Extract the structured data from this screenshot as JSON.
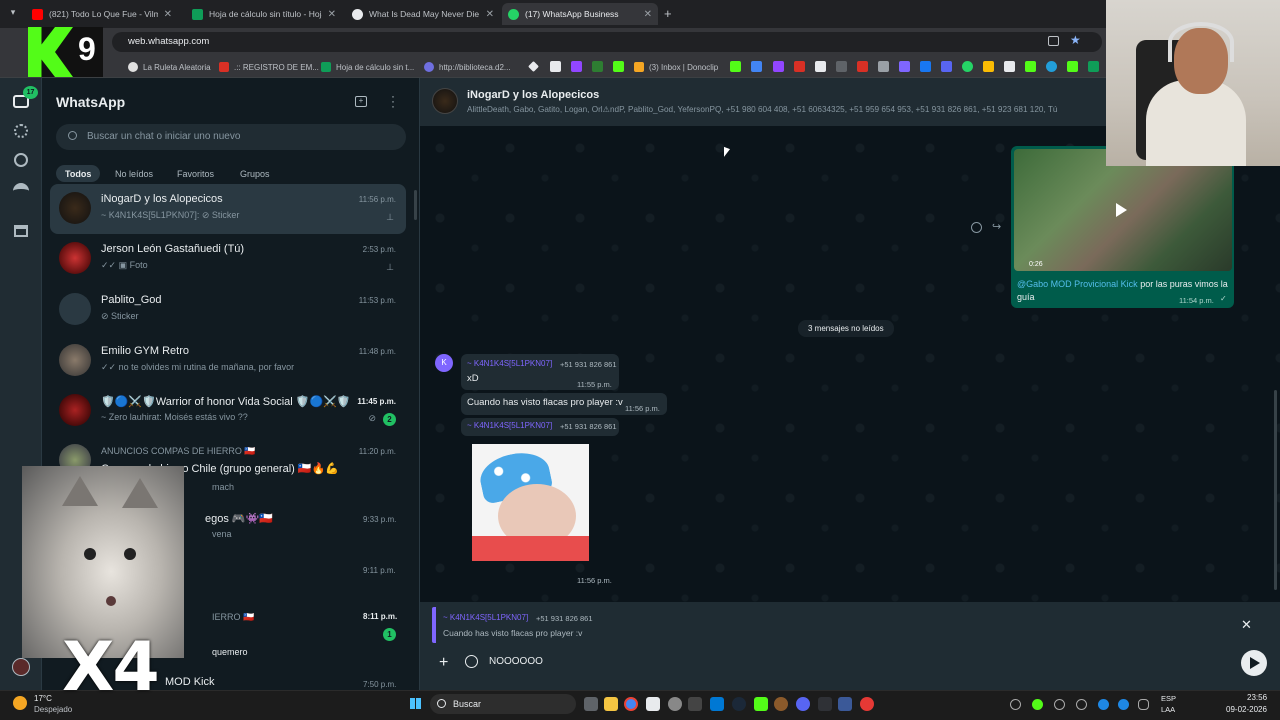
{
  "browser": {
    "tabs": [
      {
        "title": "(821) Todo Lo Que Fue - Vilma",
        "color": "#ff0000"
      },
      {
        "title": "Hoja de cálculo sin título - Hoja",
        "color": "#0f9d58"
      },
      {
        "title": "What Is Dead May Never Die -",
        "color": "#e8eaed"
      },
      {
        "title": "(17) WhatsApp Business",
        "color": "#25d366"
      }
    ],
    "url": "web.whatsapp.com",
    "bookmarks": [
      {
        "label": "La Ruleta Aleatoria",
        "color": "#e0e0e0"
      },
      {
        "label": ".:: REGISTRO DE EM...",
        "color": "#d93025"
      },
      {
        "label": "Hoja de cálculo sin t...",
        "color": "#0f9d58"
      },
      {
        "label": "http://biblioteca.d2...",
        "color": "#6f6fe0"
      },
      {
        "label": "(3) Inbox | Donoclip",
        "color": "#f5a623"
      }
    ]
  },
  "whatsapp": {
    "title": "WhatsApp",
    "unread_count": "17",
    "search_placeholder": "Buscar un chat o iniciar uno nuevo",
    "filters": [
      "Todos",
      "No leídos",
      "Favoritos",
      "Grupos"
    ],
    "chats": [
      {
        "name": "iNogarD y los Alopecicos",
        "preview": "~ K4N1K4S[5L1PKN07]: ⊘ Sticker",
        "time": "11:56 p.m.",
        "pinned": true
      },
      {
        "name": "Jerson León Gastañuedi (Tú)",
        "preview": "✓✓ ▣ Foto",
        "time": "2:53 p.m.",
        "pinned": true
      },
      {
        "name": "Pablito_God",
        "preview": "⊘ Sticker",
        "time": "11:53 p.m."
      },
      {
        "name": "Emilio GYM Retro",
        "preview": "✓✓ no te olvides mi rutina de mañana, por favor",
        "time": "11:48 p.m."
      },
      {
        "name": "🛡️🔵⚔️🛡️Warrior of honor Vida Social 🛡️🔵⚔️🛡️",
        "preview": "~ Zero lauhirat: Moisés estás vivo ??",
        "time": "11:45 p.m.",
        "badge": "2"
      },
      {
        "name": "ANUNCIOS COMPAS DE HIERRO 🇨🇱",
        "preview": "Compas de hierro Chile (grupo general) 🇨🇱🔥💪",
        "time": "11:20 p.m."
      },
      {
        "name": "",
        "preview": "mach",
        "time": ""
      },
      {
        "name": "egos 🎮👾🇨🇱",
        "preview": "vena",
        "time": "9:33 p.m."
      },
      {
        "name": "",
        "preview": "",
        "time": "9:11 p.m."
      },
      {
        "name": "IERRO 🇨🇱",
        "preview": "quemero",
        "time": "8:11 p.m.",
        "badge": "1"
      },
      {
        "name": "MOD Kick",
        "preview": "",
        "time": "7:50 p.m."
      }
    ],
    "chat": {
      "name": "iNogarD y los Alopecicos",
      "members": "AlittleDeath, Gabo, Gatito,  Logan, Orl⚠ndP, Pablito_God, YefersonPQ, +51 980 604 408, +51 60634325, +51 959 654 953, +51 931 826 861, +51 923 681 120, Tú",
      "video_msg": {
        "duration": "0:26",
        "mention": "@Gabo MOD Provicional Kick",
        "text": " por las puras vimos la guía",
        "time": "11:54 p.m."
      },
      "unread_divider": "3 mensajes no leídos",
      "messages": [
        {
          "sender": "~ K4N1K4S[5L1PKN07]",
          "phone": "+51 931 826 861",
          "text": "xD",
          "time": "11:55 p.m."
        },
        {
          "text": "Cuando has visto flacas pro player :v",
          "time": "11:56 p.m."
        },
        {
          "sender": "~ K4N1K4S[5L1PKN07]",
          "phone": "+51 931 826 861",
          "time": "11:56 p.m."
        }
      ],
      "reply": {
        "sender": "~ K4N1K4S[5L1PKN07]",
        "phone": "+51 931 826 861",
        "text": "Cuando has visto flacas pro player :v"
      },
      "input": "NOOOOOO"
    }
  },
  "overlay": {
    "logo": "9",
    "cat_text": "X4"
  },
  "taskbar": {
    "weather_temp": "17°C",
    "weather_desc": "Despejado",
    "search": "Buscar",
    "lang1": "ESP",
    "lang2": "LAA",
    "time": "23:56",
    "date": "09-02-2026"
  },
  "colors": {
    "accent": "#25d366",
    "panel": "#111b21",
    "chatbg": "#0b141a",
    "incoming": "#202c33",
    "outgoing": "#005c4b"
  },
  "icons": [
    "search-icon",
    "pin-icon",
    "mute-icon",
    "send-icon",
    "plus-icon",
    "sticker-icon",
    "close-icon",
    "menu-icon",
    "new-chat-icon",
    "play-icon"
  ]
}
